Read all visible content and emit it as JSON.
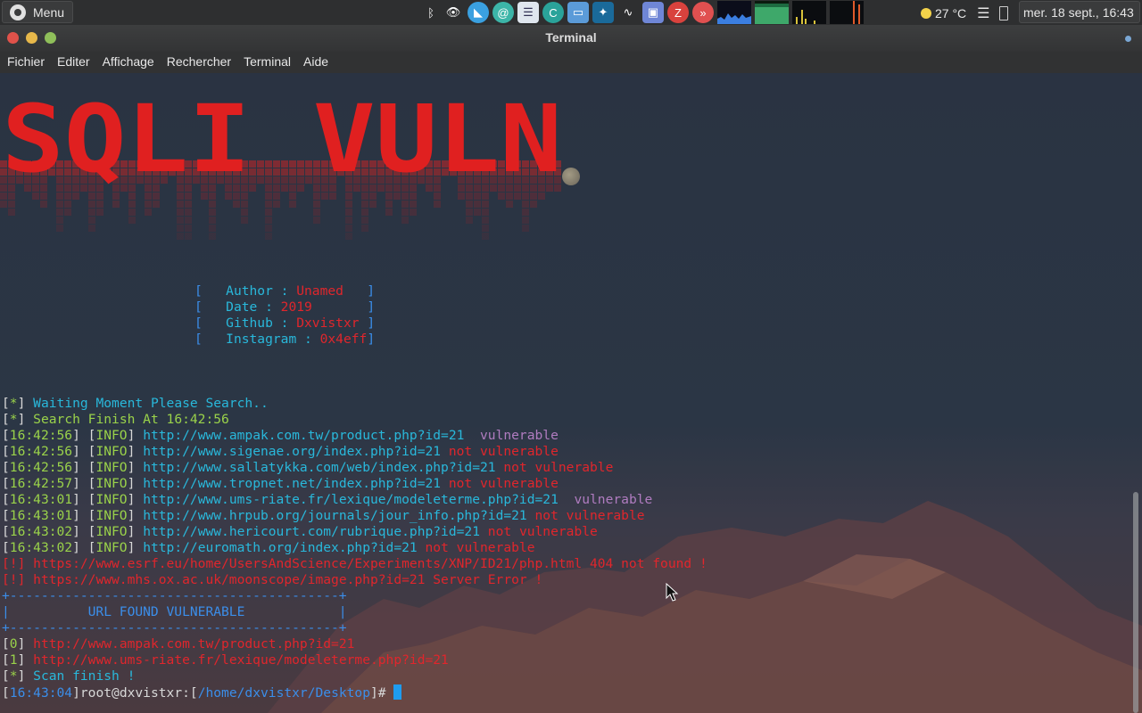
{
  "panel": {
    "menu_label": "Menu",
    "temperature": "27 °C",
    "clock": "mer. 18 sept., 16:43",
    "tray_icons": [
      "bluetooth-icon",
      "eye-icon",
      "shark-icon",
      "spiral-icon",
      "notes-icon",
      "sync-icon",
      "folder-icon",
      "kodi-icon",
      "audio-icon",
      "discord-icon",
      "filezilla-icon",
      "anydesk-icon"
    ]
  },
  "window": {
    "title": "Terminal",
    "menus": [
      "Fichier",
      "Editer",
      "Affichage",
      "Rechercher",
      "Terminal",
      "Aide"
    ]
  },
  "banner": {
    "text": "SQLI VULN",
    "info": [
      {
        "label": "Author",
        "value": "Unamed"
      },
      {
        "label": "Date",
        "value": "2019"
      },
      {
        "label": "Github",
        "value": "Dxvistxr"
      },
      {
        "label": "Instagram",
        "value": "0x4eff"
      }
    ]
  },
  "output": {
    "waiting": "Waiting Moment Please Search..",
    "search_finish": "Search Finish At 16:42:56",
    "results": [
      {
        "time": "16:42:56",
        "tag": "INFO",
        "url": "http://www.ampak.com.tw/product.php?id=21",
        "status": "vulnerable",
        "sep": "  "
      },
      {
        "time": "16:42:56",
        "tag": "INFO",
        "url": "http://www.sigenae.org/index.php?id=21",
        "status": "not vulnerable",
        "sep": " "
      },
      {
        "time": "16:42:56",
        "tag": "INFO",
        "url": "http://www.sallatykka.com/web/index.php?id=21",
        "status": "not vulnerable",
        "sep": " "
      },
      {
        "time": "16:42:57",
        "tag": "INFO",
        "url": "http://www.tropnet.net/index.php?id=21",
        "status": "not vulnerable",
        "sep": " "
      },
      {
        "time": "16:43:01",
        "tag": "INFO",
        "url": "http://www.ums-riate.fr/lexique/modeleterme.php?id=21",
        "status": "vulnerable",
        "sep": "  "
      },
      {
        "time": "16:43:01",
        "tag": "INFO",
        "url": "http://www.hrpub.org/journals/jour_info.php?id=21",
        "status": "not vulnerable",
        "sep": " "
      },
      {
        "time": "16:43:02",
        "tag": "INFO",
        "url": "http://www.hericourt.com/rubrique.php?id=21",
        "status": "not vulnerable",
        "sep": " "
      },
      {
        "time": "16:43:02",
        "tag": "INFO",
        "url": "http://euromath.org/index.php?id=21",
        "status": "not vulnerable",
        "sep": " "
      }
    ],
    "errors": [
      "https://www.esrf.eu/home/UsersAndScience/Experiments/XNP/ID21/php.html 404 not found !",
      "https://www.mhs.ox.ac.uk/moonscope/image.php?id=21 Server Error !"
    ],
    "box_border": "+------------------------------------------+",
    "box_title": "|          URL FOUND VULNERABLE            |",
    "found": [
      {
        "index": "0",
        "url": "http://www.ampak.com.tw/product.php?id=21"
      },
      {
        "index": "1",
        "url": "http://www.ums-riate.fr/lexique/modeleterme.php?id=21"
      }
    ],
    "scan_finish": "Scan finish !"
  },
  "prompt": {
    "time": "16:43:04",
    "user_host": "root@dxvistxr",
    "path": "/home/dxvistxr/Desktop",
    "symbol": "#"
  }
}
